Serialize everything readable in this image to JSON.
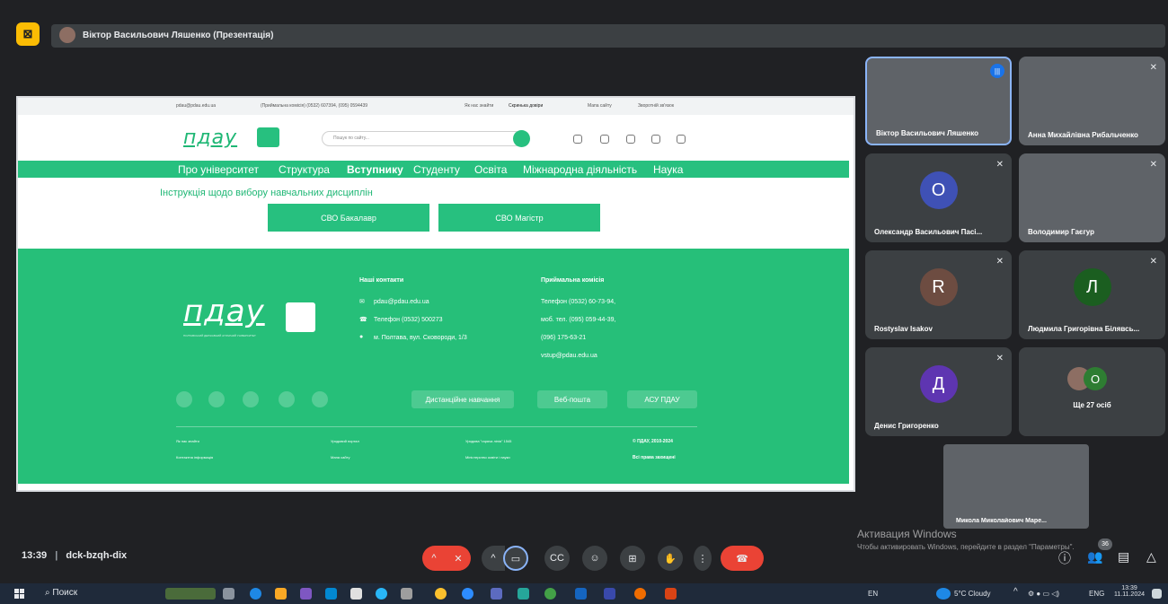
{
  "window": {
    "presenter_title": "Віктор Васильович Ляшенко (Презентація)"
  },
  "website": {
    "topbar": {
      "email": "pdau@pdau.edu.ua",
      "phone": "(Приймальна комісія) (0532) 607394, (095) 0594439",
      "links": [
        "Як нас знайти",
        "Скринька довіри",
        "Мапа сайту",
        "Зворотній зв'язок"
      ]
    },
    "logo": "пдау",
    "search_placeholder": "Пошук по сайту...",
    "nav": [
      "Про університет",
      "Структура",
      "Вступнику",
      "Студенту",
      "Освіта",
      "Міжнародна діяльність",
      "Наука"
    ],
    "instruction": "Інструкція щодо вибору навчальних дисциплін",
    "buttons": [
      "СВО Бакалавр",
      "СВО Магістр"
    ],
    "footer": {
      "university_caption": "ПОЛТАВСЬКИЙ ДЕРЖАВНИЙ АГРАРНИЙ УНІВЕРСИТЕТ",
      "contacts_title": "Наші контакти",
      "contacts": [
        "pdau@pdau.edu.ua",
        "Телефон (0532) 500273",
        "м. Полтава, вул. Сковороди, 1/3"
      ],
      "admission_title": "Приймальна комісія",
      "admission": [
        "Телефон (0532) 60-73-94,",
        "моб. тел. (095) 059-44-39,",
        "(096) 175-63-21",
        "vstup@pdau.edu.ua"
      ],
      "pills": [
        "Дистанційне навчання",
        "Веб-пошта",
        "АСУ ПДАУ"
      ],
      "bottom_links": [
        [
          "Як нас знайти",
          "Контактна інформація"
        ],
        [
          "Урядовий портал",
          "Мапа сайту"
        ],
        [
          "Урядова \"гаряча лінія\" 1545",
          "Міністерство освіти і науки"
        ],
        [
          "© ПДАУ, 2010-2024",
          "Всі права захищені"
        ]
      ]
    }
  },
  "participants": [
    {
      "name": "Віктор Васильович Ляшенко",
      "type": "video",
      "speaking": true
    },
    {
      "name": "Анна Михайлівна Рибальченко",
      "type": "video",
      "muted": true
    },
    {
      "name": "Олександр Васильович Пасі...",
      "type": "avatar",
      "initial": "О",
      "color": "#3f51b5",
      "muted": true
    },
    {
      "name": "Володимир Гаєгур",
      "type": "video",
      "muted": true
    },
    {
      "name": "Rostyslav Isakov",
      "type": "avatar",
      "initial": "R",
      "color": "#6d4c41",
      "muted": true
    },
    {
      "name": "Людмила Григорівна Білявсь...",
      "type": "avatar",
      "initial": "Л",
      "color": "#1b5e20",
      "muted": true
    },
    {
      "name": "Денис Григоренко",
      "type": "avatar",
      "initial": "Д",
      "color": "#5e35b1",
      "muted": true
    },
    {
      "name": "Ще 27 осіб",
      "type": "more",
      "initial": "О",
      "color": "#2e7d32"
    }
  ],
  "self_view": {
    "name": "Микола Миколайович Маре..."
  },
  "meeting": {
    "time": "13:39",
    "code": "dck-bzqh-dix",
    "participants_count": "36"
  },
  "activation": {
    "title": "Активация Windows",
    "subtitle": "Чтобы активировать Windows, перейдите в раздел \"Параметры\"."
  },
  "taskbar": {
    "search": "Поиск",
    "lang_left": "EN",
    "weather": "5°C Cloudy",
    "lang": "ENG",
    "clock_time": "13:39",
    "clock_date": "11.11.2024"
  }
}
